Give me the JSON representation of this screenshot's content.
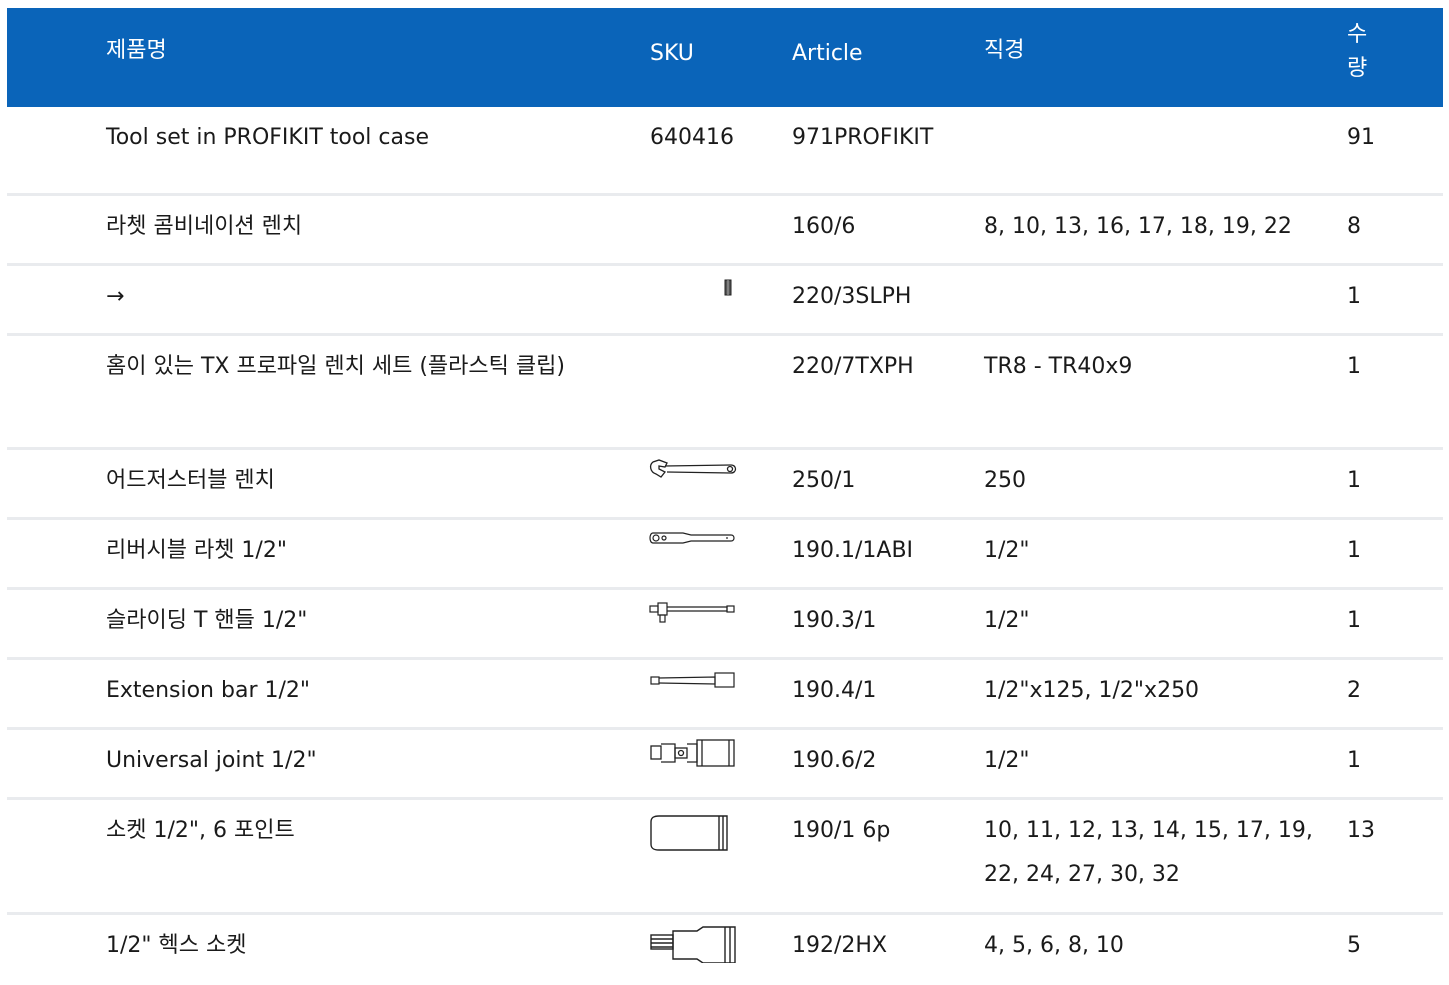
{
  "table": {
    "headers": {
      "name": "제품명",
      "sku": "SKU",
      "article": "Article",
      "diameter": "직경",
      "qty_line1": "수",
      "qty_line2": "량"
    },
    "rows": [
      {
        "name": "Tool set in PROFIKIT tool case",
        "sku": "640416",
        "article": "971PROFIKIT",
        "diameter": "",
        "qty": "91",
        "icon": ""
      },
      {
        "name": "라쳇 콤비네이션 렌치",
        "sku": "",
        "article": "160/6",
        "diameter": "8, 10, 13, 16, 17, 18, 19, 22",
        "qty": "8",
        "icon": ""
      },
      {
        "name": "→",
        "sku": "",
        "article": "220/3SLPH",
        "diameter": "",
        "qty": "1",
        "icon": "small-bit-icon"
      },
      {
        "name": "홈이 있는 TX 프로파일 렌치 세트 (플라스틱 클립)",
        "sku": "",
        "article": "220/7TXPH",
        "diameter": "TR8 - TR40x9",
        "qty": "1",
        "icon": ""
      },
      {
        "name": "어드저스터블 렌치",
        "sku": "",
        "article": "250/1",
        "diameter": "250",
        "qty": "1",
        "icon": "adjustable-wrench-icon"
      },
      {
        "name": "리버시블 라쳇 1/2\"",
        "sku": "",
        "article": "190.1/1ABI",
        "diameter": "1/2\"",
        "qty": "1",
        "icon": "ratchet-icon"
      },
      {
        "name": "슬라이딩 T 핸들 1/2\"",
        "sku": "",
        "article": "190.3/1",
        "diameter": "1/2\"",
        "qty": "1",
        "icon": "t-handle-icon"
      },
      {
        "name": "Extension bar 1/2\"",
        "sku": "",
        "article": "190.4/1",
        "diameter": "1/2\"x125, 1/2\"x250",
        "qty": "2",
        "icon": "extension-bar-icon"
      },
      {
        "name": "Universal joint 1/2\"",
        "sku": "",
        "article": "190.6/2",
        "diameter": "1/2\"",
        "qty": "1",
        "icon": "universal-joint-icon"
      },
      {
        "name": "소켓 1/2\", 6 포인트",
        "sku": "",
        "article": "190/1 6p",
        "diameter": "10, 11, 12, 13, 14, 15, 17, 19, 22, 24, 27, 30, 32",
        "qty": "13",
        "icon": "socket-icon"
      },
      {
        "name": "1/2\" 헥스 소켓",
        "sku": "",
        "article": "192/2HX",
        "diameter": "4, 5, 6, 8, 10",
        "qty": "5",
        "icon": "hex-socket-icon"
      }
    ]
  }
}
